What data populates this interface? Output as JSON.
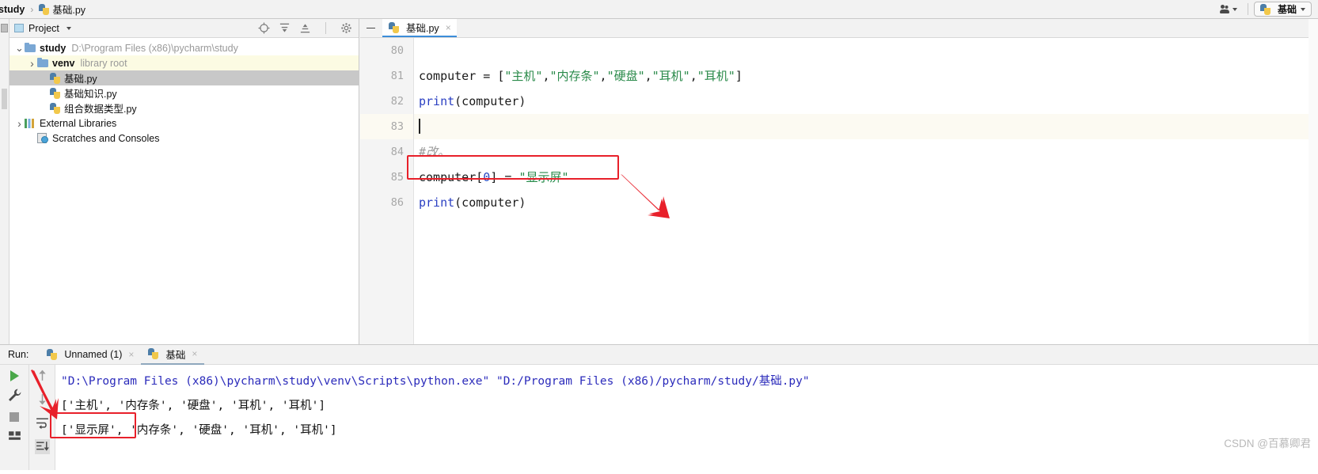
{
  "breadcrumb": {
    "project": "study",
    "separator": "›",
    "file": "基础.py"
  },
  "topbar": {
    "people_icon": "people-icon",
    "run_config_name": "基础",
    "run_config_caret": "caret-down-icon"
  },
  "project_panel": {
    "title": "Project",
    "tools": [
      "target-icon",
      "expand-all-icon",
      "collapse-all-icon",
      "gear-icon"
    ],
    "collapse_label": "minimize-icon",
    "tree": [
      {
        "name": "study",
        "path": "D:\\Program Files (x86)\\pycharm\\study",
        "type": "folder",
        "bold": true,
        "arrow": "⌄",
        "indent": 0,
        "highlight": "none"
      },
      {
        "name": "venv",
        "path": "library root",
        "type": "folder",
        "bold": true,
        "arrow": "›",
        "indent": 1,
        "highlight": "yellow"
      },
      {
        "name": "基础.py",
        "path": "",
        "type": "python",
        "bold": false,
        "arrow": "",
        "indent": 2,
        "highlight": "gray"
      },
      {
        "name": "基础知识.py",
        "path": "",
        "type": "python",
        "bold": false,
        "arrow": "",
        "indent": 2,
        "highlight": "none"
      },
      {
        "name": "组合数据类型.py",
        "path": "",
        "type": "python",
        "bold": false,
        "arrow": "",
        "indent": 2,
        "highlight": "none"
      },
      {
        "name": "External Libraries",
        "path": "",
        "type": "library",
        "bold": false,
        "arrow": "›",
        "indent": 0,
        "highlight": "none"
      },
      {
        "name": "Scratches and Consoles",
        "path": "",
        "type": "scratch",
        "bold": false,
        "arrow": "",
        "indent": 1,
        "highlight": "none"
      }
    ]
  },
  "editor": {
    "tab_label": "基础.py",
    "tab_close": "×",
    "lines": [
      {
        "num": "80",
        "segments": [],
        "current": false
      },
      {
        "num": "81",
        "segments": [
          {
            "t": "computer = [",
            "c": "plain"
          },
          {
            "t": "\"主机\"",
            "c": "str"
          },
          {
            "t": ",",
            "c": "plain"
          },
          {
            "t": "\"内存条\"",
            "c": "str"
          },
          {
            "t": ",",
            "c": "plain"
          },
          {
            "t": "\"硬盘\"",
            "c": "str"
          },
          {
            "t": ",",
            "c": "plain"
          },
          {
            "t": "\"耳机\"",
            "c": "str"
          },
          {
            "t": ",",
            "c": "plain"
          },
          {
            "t": "\"耳机\"",
            "c": "str"
          },
          {
            "t": "]",
            "c": "plain"
          }
        ],
        "current": false
      },
      {
        "num": "82",
        "segments": [
          {
            "t": "print",
            "c": "fn"
          },
          {
            "t": "(computer)",
            "c": "plain"
          }
        ],
        "current": false
      },
      {
        "num": "83",
        "segments": [],
        "current": true,
        "caret": true
      },
      {
        "num": "84",
        "segments": [
          {
            "t": "#改。",
            "c": "com"
          }
        ],
        "current": false
      },
      {
        "num": "85",
        "segments": [
          {
            "t": "computer[",
            "c": "plain"
          },
          {
            "t": "0",
            "c": "num"
          },
          {
            "t": "] = ",
            "c": "plain"
          },
          {
            "t": "\"显示屏\"",
            "c": "str"
          }
        ],
        "current": false
      },
      {
        "num": "86",
        "segments": [
          {
            "t": "print",
            "c": "fn"
          },
          {
            "t": "(computer)",
            "c": "plain"
          }
        ],
        "current": false
      }
    ]
  },
  "run_panel": {
    "label": "Run:",
    "tabs": [
      {
        "label": "Unnamed (1)",
        "active": false,
        "close": "×"
      },
      {
        "label": "基础",
        "active": true,
        "close": "×"
      }
    ],
    "toolbar_left": [
      "run-icon",
      "wrench-icon",
      "stop-icon",
      "layout-icon"
    ],
    "toolbar_right": [
      "up-arrow-icon",
      "down-arrow-icon",
      "soft-wrap-icon",
      "scroll-to-end-icon"
    ],
    "console": [
      {
        "text": "\"D:\\Program Files (x86)\\pycharm\\study\\venv\\Scripts\\python.exe\" \"D:/Program Files (x86)/pycharm/study/基础.py\"",
        "color": "blue"
      },
      {
        "text": "['主机', '内存条', '硬盘', '耳机', '耳机']",
        "color": "dark"
      },
      {
        "text": "['显示屏', '内存条', '硬盘', '耳机', '耳机']",
        "color": "dark"
      }
    ]
  },
  "annotations": {
    "code_box": "red-highlight-box",
    "output_box": "red-highlight-box",
    "arrow_code": "red-arrow",
    "arrow_output": "red-arrow",
    "accent_red": "#e8202a"
  },
  "watermark": "CSDN @百慕卿君"
}
